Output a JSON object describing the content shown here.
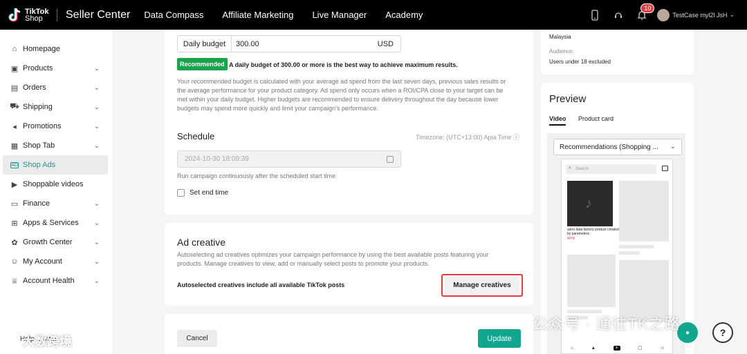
{
  "topbar": {
    "logo_line1": "TikTok",
    "logo_line2": "Shop",
    "brand": "Seller Center",
    "nav": [
      "Data Compass",
      "Affiliate Marketing",
      "Live Manager",
      "Academy"
    ],
    "notification_count": "10",
    "user_name": "TestCase myl2l JsH"
  },
  "sidebar": {
    "items": [
      {
        "label": "Homepage",
        "icon": "home-icon",
        "expandable": false
      },
      {
        "label": "Products",
        "icon": "box-icon",
        "expandable": true
      },
      {
        "label": "Orders",
        "icon": "clipboard-icon",
        "expandable": true
      },
      {
        "label": "Shipping",
        "icon": "truck-icon",
        "expandable": true
      },
      {
        "label": "Promotions",
        "icon": "megaphone-icon",
        "expandable": true
      },
      {
        "label": "Shop Tab",
        "icon": "shop-icon",
        "expandable": true
      },
      {
        "label": "Shop Ads",
        "icon": "ad-icon",
        "expandable": false,
        "active": true
      },
      {
        "label": "Shoppable videos",
        "icon": "video-icon",
        "expandable": false
      },
      {
        "label": "Finance",
        "icon": "finance-icon",
        "expandable": true
      },
      {
        "label": "Apps & Services",
        "icon": "apps-icon",
        "expandable": true
      },
      {
        "label": "Growth Center",
        "icon": "growth-icon",
        "expandable": true
      },
      {
        "label": "My Account",
        "icon": "user-icon",
        "expandable": true
      },
      {
        "label": "Account Health",
        "icon": "trophy-icon",
        "expandable": true
      }
    ],
    "help_center": "Help Center"
  },
  "budget": {
    "label": "Daily budget",
    "value": "300.00",
    "currency": "USD",
    "recommended_tag": "Recommended",
    "recommended_text": "A daily budget of 300.00 or more is the best way to achieve maximum results.",
    "description": "Your recommended budget is calculated with your average ad spend from the last seven days, previous sales results or the average performance for your product category. Ad spend only occurs when a ROI/CPA close to your target can be met within your daily budget. Higher budgets are recommended to ensure delivery throughout the day because lower budgets may spend more quickly and limit your campaign's performance."
  },
  "schedule": {
    "title": "Schedule",
    "timezone": "Timezone: (UTC+13:00) Apia Time",
    "start_value": "2024-10-30 18:09:39",
    "hint": "Run campaign continuously after the scheduled start time",
    "end_time_label": "Set end time"
  },
  "ad_creative": {
    "title": "Ad creative",
    "description": "Autoselecting ad creatives optimizes your campaign performance by using the best available posts featuring your products. Manage creatives to view, add or manually select posts to promote your products.",
    "auto_text": "Autoselected creatives include all available TikTok posts",
    "manage_button": "Manage creatives"
  },
  "footer": {
    "cancel": "Cancel",
    "update": "Update"
  },
  "targeting": {
    "location": "Malaysia",
    "audience_label": "Audience:",
    "audience_value": "Users under 18 excluded"
  },
  "preview": {
    "title": "Preview",
    "tabs": [
      "Video",
      "Product card"
    ],
    "dropdown_value": "Recommendations (Shopping ...",
    "search_placeholder": "Search",
    "product_caption": "astro data factory product created by parameters",
    "product_price": "MYR"
  },
  "watermark": {
    "right": "公众号 · 通往TK之路",
    "left": "大数跨境"
  }
}
